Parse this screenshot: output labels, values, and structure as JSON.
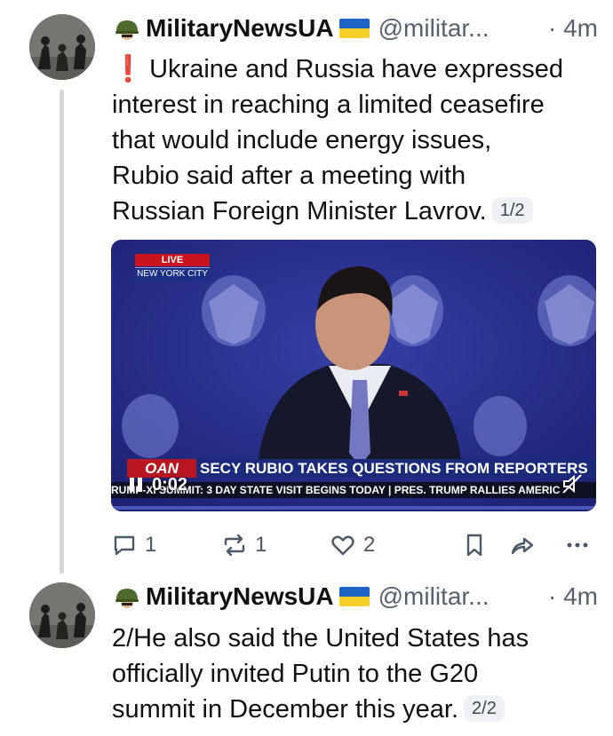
{
  "posts": [
    {
      "author": "MilitaryNewsUA",
      "handle": "@militar...",
      "time": "· 4m",
      "alert_icon": "❗",
      "text_lines": [
        "Ukraine and Russia have expressed",
        "interest in reaching a limited ceasefire",
        "that would include energy issues,",
        "Rubio said after a meeting with",
        "Russian Foreign Minister Lavrov."
      ],
      "counter": "1/2",
      "video": {
        "live_badge": "LIVE",
        "location_badge": "NEW YORK CITY",
        "network_logo": "OAN",
        "headline": "SECY RUBIO TAKES QUESTIONS FROM REPORTERS",
        "ticker": "RUMP-XI SUMMIT: 3 DAY STATE VISIT BEGINS TODAY  |  PRES. TRUMP RALLIES AMERIC",
        "elapsed": "0:02",
        "play_state_icon": "pause-icon",
        "mute_icon": "mute-icon"
      },
      "actions": {
        "replies": "1",
        "reposts": "1",
        "likes": "2"
      }
    },
    {
      "author": "MilitaryNewsUA",
      "handle": "@militar...",
      "time": "· 4m",
      "text_lines": [
        "2/He also said the United States has",
        "officially invited Putin to the G20",
        "summit in December this year."
      ],
      "counter": "2/2"
    }
  ],
  "colors": {
    "secondary_text": "#55616f",
    "thread_line": "#d4d7dc",
    "alert_red": "#e0112b",
    "video_bg": "#2b2f8c"
  }
}
